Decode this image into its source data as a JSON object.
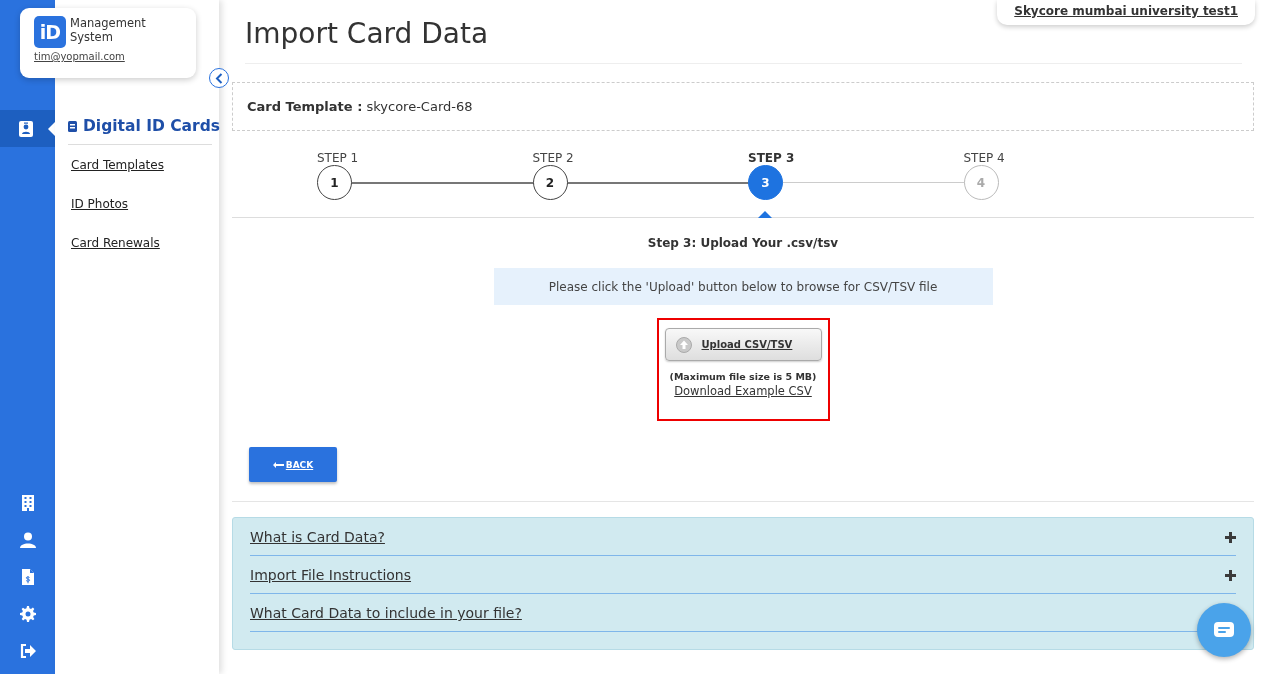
{
  "rail": {
    "items": [
      {
        "kind": "card",
        "selected": true
      },
      {
        "kind": "building",
        "selected": false
      },
      {
        "kind": "person",
        "selected": false
      },
      {
        "kind": "invoice",
        "selected": false
      },
      {
        "kind": "settings",
        "selected": false
      },
      {
        "kind": "logout",
        "selected": false
      }
    ]
  },
  "brand": {
    "logo": "iD",
    "name": "Management System",
    "email": "tim@yopmail.com"
  },
  "submenu": {
    "title": "Digital ID Cards",
    "items": [
      "Card Templates",
      "ID Photos",
      "Card Renewals"
    ]
  },
  "organization": "Skycore mumbai university test1",
  "page_title": "Import Card Data",
  "template": {
    "label": "Card Template :",
    "value": "skycore-Card-68"
  },
  "steps": [
    {
      "label": "STEP 1",
      "number": "1",
      "done": true,
      "selected": false
    },
    {
      "label": "STEP 2",
      "number": "2",
      "done": true,
      "selected": false
    },
    {
      "label": "STEP 3",
      "number": "3",
      "done": false,
      "selected": true
    },
    {
      "label": "STEP 4",
      "number": "4",
      "done": false,
      "selected": false
    }
  ],
  "step_heading": "Step 3: Upload Your .csv/tsv",
  "info": "Please click the 'Upload' button below to browse for CSV/TSV file",
  "upload": {
    "button": "Upload CSV/TSV",
    "limit": "(Maximum file size is 5 MB)",
    "example_link": "Download Example CSV"
  },
  "back_button": "BACK",
  "faq": [
    {
      "title": "What is Card Data?",
      "expanded": false
    },
    {
      "title": "Import File Instructions",
      "expanded": false
    },
    {
      "title": "What Card Data to include in your file?"
    }
  ]
}
